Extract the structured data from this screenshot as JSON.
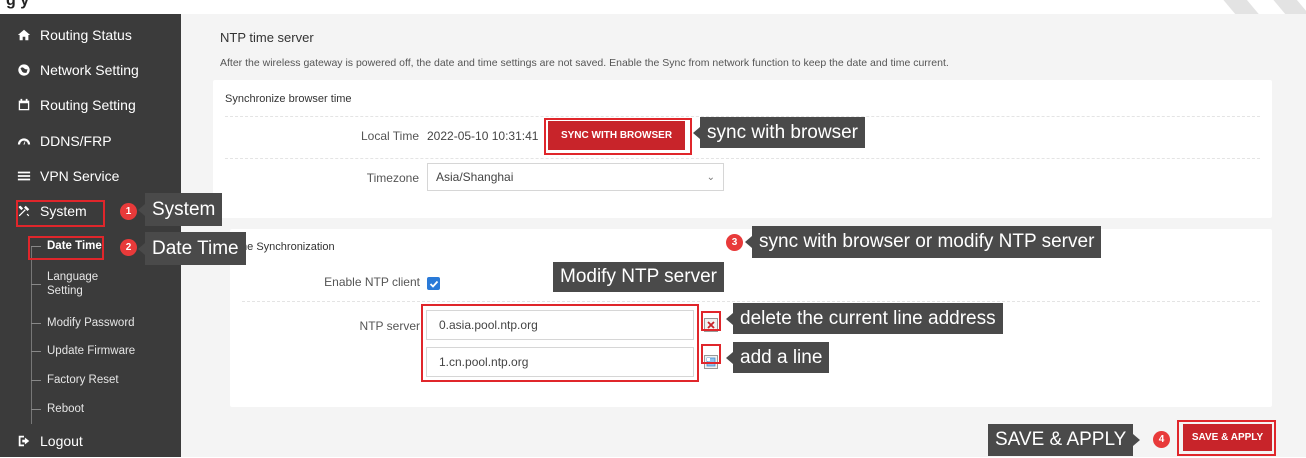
{
  "top_strip": {
    "text": "g                   y"
  },
  "sidebar": {
    "items": [
      {
        "label": "Routing Status",
        "icon": "home-icon"
      },
      {
        "label": "Network Setting",
        "icon": "globe-icon"
      },
      {
        "label": "Routing Setting",
        "icon": "calendar-icon"
      },
      {
        "label": "DDNS/FRP",
        "icon": "gauge-icon"
      },
      {
        "label": "VPN Service",
        "icon": "list-icon"
      },
      {
        "label": "System",
        "icon": "tools-icon"
      }
    ],
    "sub_items": [
      {
        "label": "Date Time"
      },
      {
        "label": "Language Setting"
      },
      {
        "label": "Modify Password"
      },
      {
        "label": "Update Firmware"
      },
      {
        "label": "Factory Reset"
      },
      {
        "label": "Reboot"
      }
    ],
    "logout": {
      "label": "Logout",
      "icon": "logout-icon"
    }
  },
  "main": {
    "title": "NTP time server",
    "description": "After the wireless gateway is powered off, the date and time settings are not saved. Enable the Sync from network function to keep the date and time current.",
    "sync_card": {
      "title": "Synchronize browser time",
      "local_time_label": "Local Time",
      "local_time_value": "2022-05-10 10:31:41",
      "sync_button": "SYNC WITH BROWSER",
      "timezone_label": "Timezone",
      "timezone_value": "Asia/Shanghai"
    },
    "ntp_card": {
      "title": "me Synchronization",
      "enable_label": "Enable NTP client",
      "enable_checked": true,
      "server_label": "NTP server",
      "servers": [
        "0.asia.pool.ntp.org",
        "1.cn.pool.ntp.org"
      ]
    },
    "save_button": "SAVE & APPLY"
  },
  "annotations": {
    "badges": [
      "1",
      "2",
      "3",
      "4"
    ],
    "callouts": {
      "system": "System",
      "date_time": "Date Time",
      "sync_browser": "sync with browser",
      "sync_or_modify": "sync with browser or modify NTP server",
      "modify_ntp": "Modify NTP server",
      "delete_line": "delete the current line address",
      "add_line": "add a line",
      "save_apply": "SAVE & APPLY"
    }
  },
  "colors": {
    "sidebar_bg": "#3b3b3b",
    "accent_red": "#c8242a",
    "annotation_red": "#e0262b",
    "callout_bg": "#4a4a4a",
    "checkbox_blue": "#2a7ad8"
  }
}
